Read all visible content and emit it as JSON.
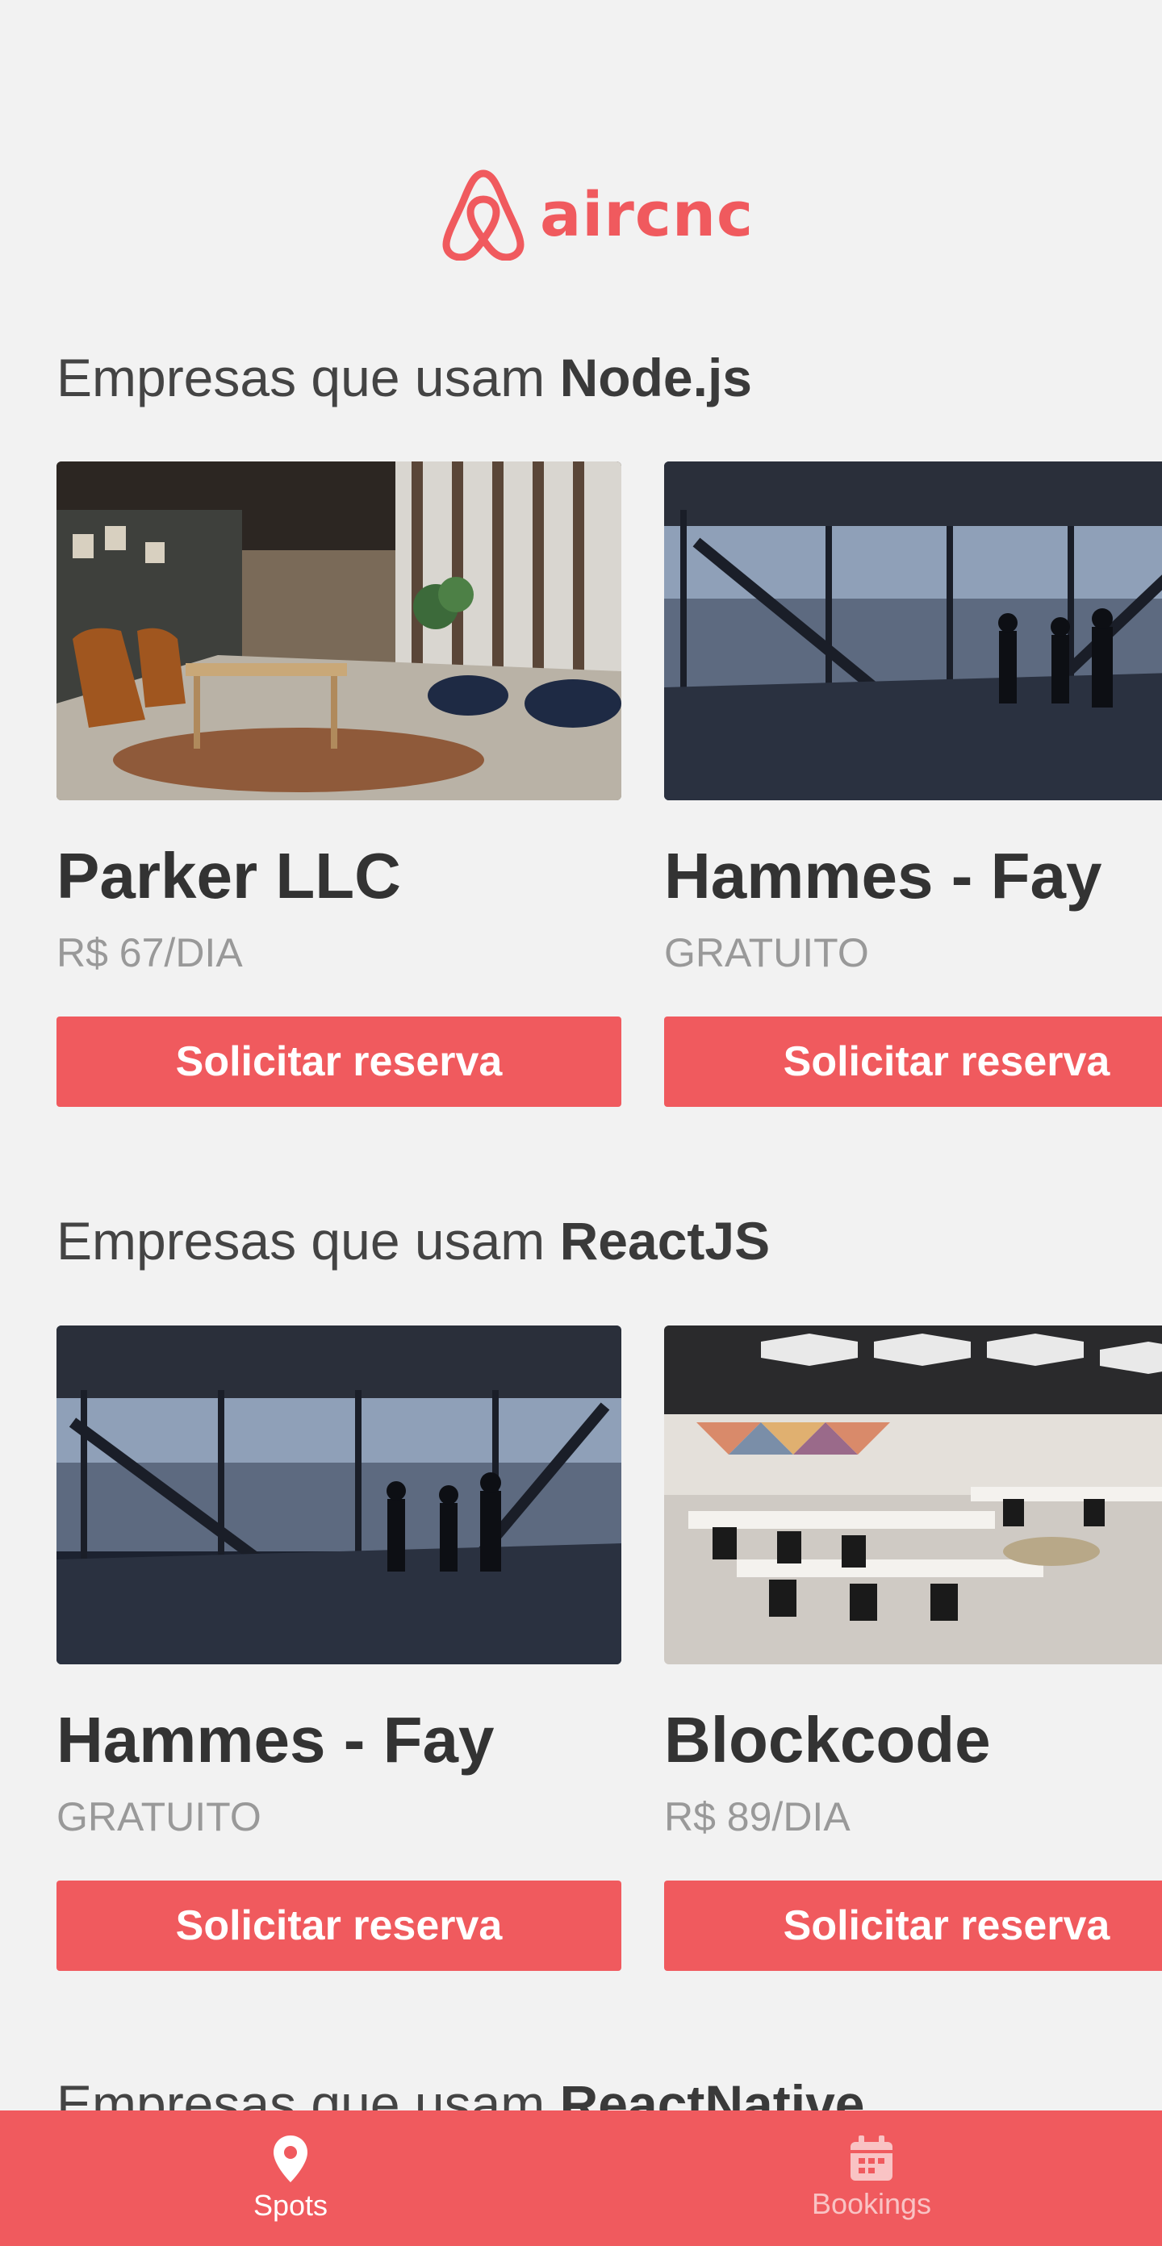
{
  "app": {
    "logo_text": "aircnc",
    "brand_color": "#f05a5e"
  },
  "sections": [
    {
      "title_prefix": "Empresas que usam ",
      "tech": "Node.js",
      "spots": [
        {
          "name": "Parker LLC",
          "price": "R$ 67/DIA",
          "button": "Solicitar reserva",
          "image": "coworking-lounge-photo"
        },
        {
          "name": "Hammes - Fay",
          "price": "GRATUITO",
          "button": "Solicitar reserva",
          "image": "office-window-silhouettes-photo"
        }
      ]
    },
    {
      "title_prefix": "Empresas que usam ",
      "tech": "ReactJS",
      "spots": [
        {
          "name": "Hammes - Fay",
          "price": "GRATUITO",
          "button": "Solicitar reserva",
          "image": "office-window-silhouettes-photo"
        },
        {
          "name": "Blockcode",
          "price": "R$ 89/DIA",
          "button": "Solicitar reserva",
          "image": "open-plan-office-photo"
        }
      ]
    },
    {
      "title_prefix": "Empresas que usam ",
      "tech": "ReactNative",
      "spots": []
    }
  ],
  "tabbar": {
    "tabs": [
      {
        "label": "Spots",
        "icon": "map-pin-icon",
        "active": true
      },
      {
        "label": "Bookings",
        "icon": "calendar-icon",
        "active": false
      }
    ]
  }
}
